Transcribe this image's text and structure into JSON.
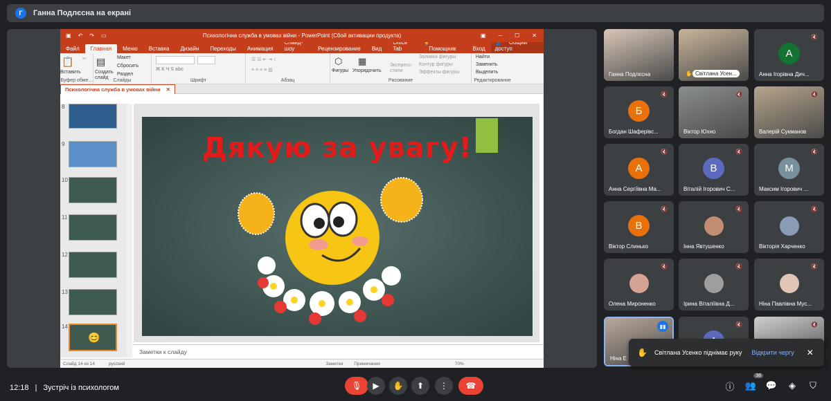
{
  "presenter_banner": {
    "avatar_letter": "Г",
    "text": "Ганна Подлєсна на екрані"
  },
  "powerpoint": {
    "title": "Психологічна служба в умовах війни - PowerPoint (Сбой активации продукта)",
    "login": "Вход",
    "tabs": [
      "Файл",
      "Главная",
      "Меню",
      "Вставка",
      "Дизайн",
      "Переходы",
      "Анимация",
      "Слайд-шоу",
      "Рецензирование",
      "Вид",
      "Office Tab"
    ],
    "tell_me": "Помощник",
    "share": "Общий доступ",
    "ribbon": {
      "paste": "Вставить",
      "clipboard": "Буфер обме...",
      "new_slide": "Создать слайд",
      "layout": "Макет",
      "reset": "Сбросить",
      "section": "Раздел",
      "slides": "Слайды",
      "font": "Шрифт",
      "paragraph": "Абзац",
      "shapes": "Фигуры",
      "arrange": "Упорядочить",
      "quick_styles": "Экспресс-стили",
      "fill": "Заливка фигуры",
      "outline": "Контур фигуры",
      "effects": "Эффекты фигуры",
      "drawing": "Рисование",
      "find": "Найти",
      "replace": "Заменить",
      "select": "Выделить",
      "editing": "Редактирование"
    },
    "doc_tab": "Психологічна служба в умовах війни",
    "thumb_numbers": [
      "8",
      "9",
      "10",
      "11",
      "12",
      "13",
      "14"
    ],
    "slide_text": "Дякую за увагу!",
    "notes_placeholder": "Заметки к слайду",
    "status": {
      "slide": "Слайд 14 из 14",
      "lang": "русский",
      "notes": "Заметки",
      "comments": "Примечания",
      "zoom": "70%"
    }
  },
  "participants": [
    {
      "name": "Ганна Подлєсна",
      "type": "photo",
      "color": "#d9c7b8"
    },
    {
      "name": "Світлана Усен...",
      "type": "photo",
      "color": "#c9b59a",
      "pinned": true
    },
    {
      "name": "Анна Ігорівна Дич...",
      "type": "letter",
      "letter": "А",
      "color": "#137333"
    },
    {
      "name": "Богдан Шаферівс...",
      "type": "letter",
      "letter": "Б",
      "color": "#e8710a"
    },
    {
      "name": "Віктор Юхно",
      "type": "photo",
      "color": "#8a8f8c"
    },
    {
      "name": "Валерій Сукманов",
      "type": "photo",
      "color": "#b7a58c"
    },
    {
      "name": "Анна Сергіївна Ма...",
      "type": "letter",
      "letter": "А",
      "color": "#e8710a"
    },
    {
      "name": "Віталій Ігорович С...",
      "type": "letter",
      "letter": "В",
      "color": "#5c6bc0"
    },
    {
      "name": "Максим Ігорович ...",
      "type": "letter",
      "letter": "М",
      "color": "#78909c"
    },
    {
      "name": "Віктор Слинько",
      "type": "letter",
      "letter": "В",
      "color": "#e8710a"
    },
    {
      "name": "Інна Явтушенко",
      "type": "avatar",
      "color": "#c28e73"
    },
    {
      "name": "Вікторія Харченко",
      "type": "avatar",
      "color": "#8a9bb5"
    },
    {
      "name": "Олена Мироненко",
      "type": "avatar",
      "color": "#d4a394"
    },
    {
      "name": "Ірина Віталіївна Д...",
      "type": "avatar",
      "color": "#9e9e9e"
    },
    {
      "name": "Ніна Павлівна Мус...",
      "type": "avatar",
      "color": "#e0c4b6"
    },
    {
      "name": "Ніна Е",
      "type": "photo",
      "color": "#b9a89a"
    },
    {
      "name": "",
      "type": "letter",
      "letter": "А",
      "color": "#5c6bc0"
    },
    {
      "name": "",
      "type": "photo",
      "color": "#cfcfcf"
    }
  ],
  "toast": {
    "text": "Світлана Усенко піднімає руку",
    "action": "Відкрити чергу"
  },
  "bottom": {
    "time": "12:18",
    "separator": "|",
    "meeting": "Зустріч із психологом",
    "people_count": "38"
  },
  "colors": {
    "ppt_accent": "#c43e1c",
    "end_call": "#ea4335",
    "meet_bg": "#202124",
    "tile_bg": "#3c4043"
  }
}
